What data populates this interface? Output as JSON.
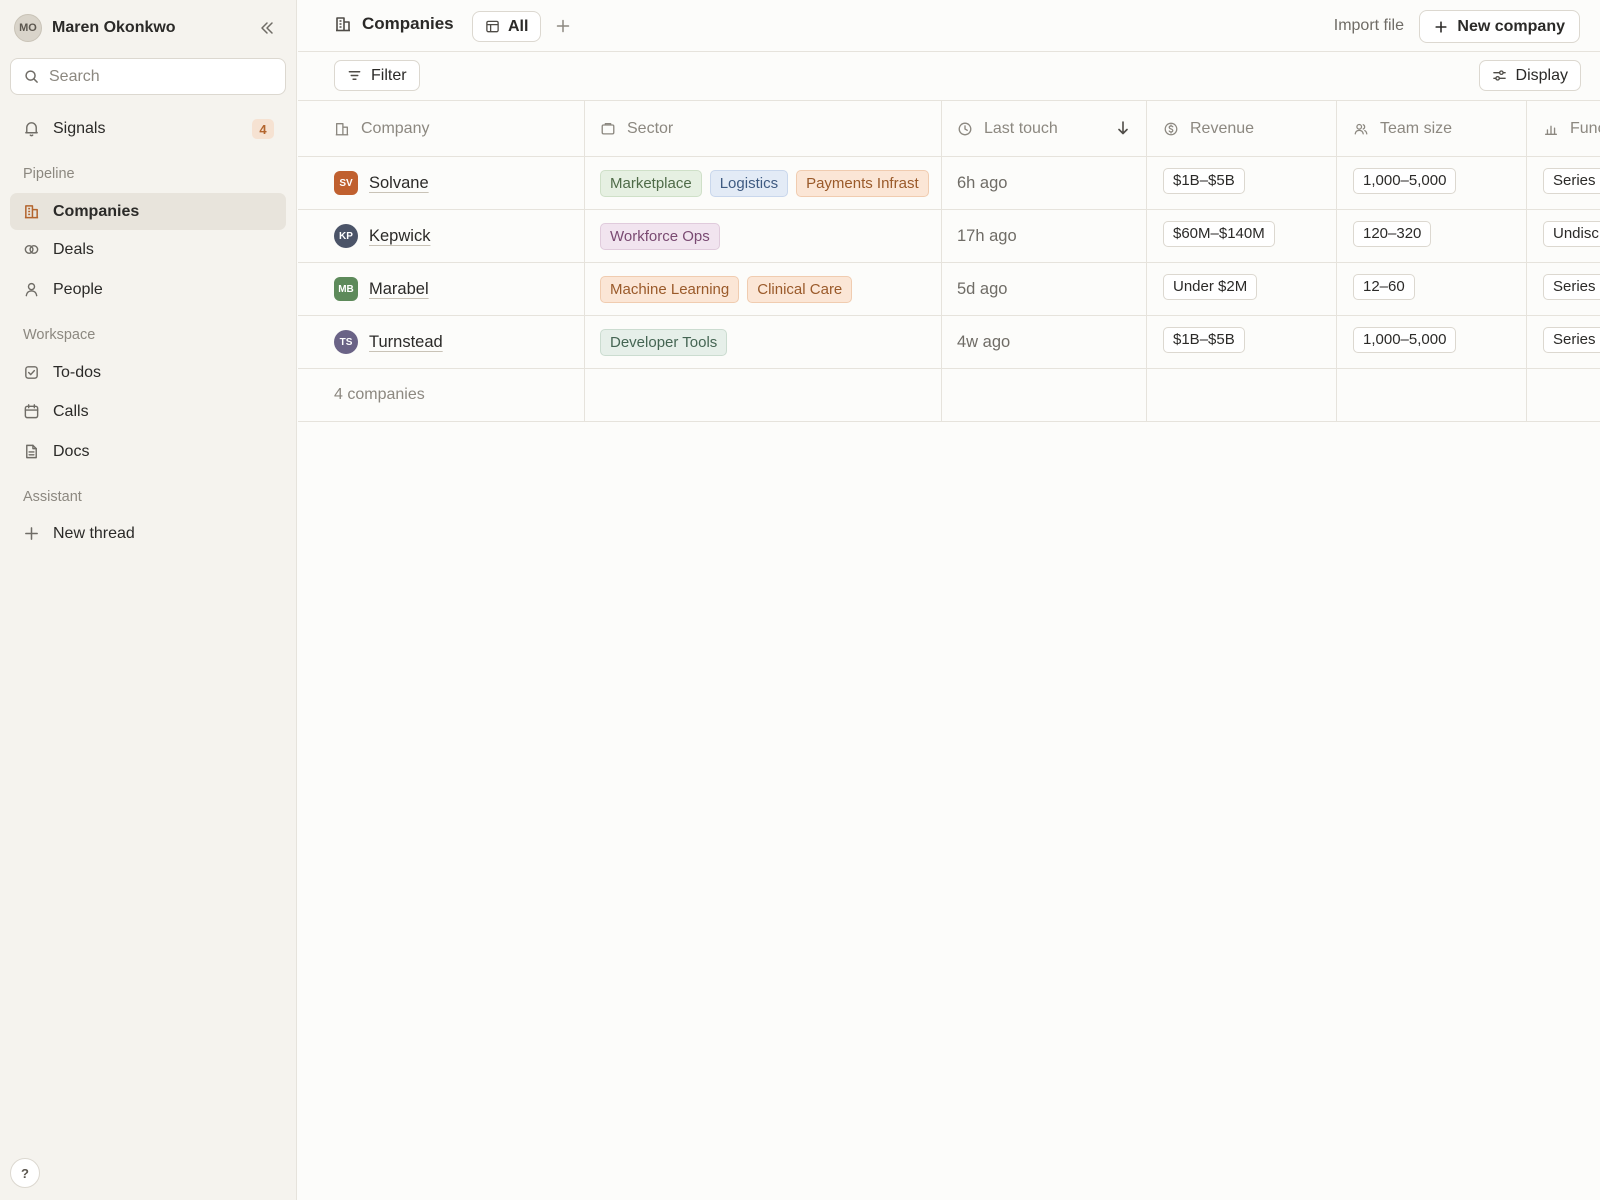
{
  "user": {
    "initials": "MO",
    "name": "Maren Okonkwo"
  },
  "search": {
    "placeholder": "Search"
  },
  "sidebar": {
    "signals": {
      "label": "Signals",
      "count": "4"
    },
    "sections": {
      "pipeline": "Pipeline",
      "workspace": "Workspace",
      "assistant": "Assistant"
    },
    "pipeline_items": [
      {
        "label": "Companies",
        "icon": "building-icon"
      },
      {
        "label": "Deals",
        "icon": "deals-icon"
      },
      {
        "label": "People",
        "icon": "person-icon"
      }
    ],
    "workspace_items": [
      {
        "label": "To-dos",
        "icon": "checkbox-icon"
      },
      {
        "label": "Calls",
        "icon": "calendar-icon"
      },
      {
        "label": "Docs",
        "icon": "document-icon"
      }
    ],
    "assistant_items": [
      {
        "label": "New thread",
        "icon": "plus-icon"
      }
    ],
    "help": "?"
  },
  "header": {
    "title": "Companies",
    "view_tab": "All",
    "import_label": "Import file",
    "new_label": "New company"
  },
  "toolbar": {
    "filter_label": "Filter",
    "display_label": "Display"
  },
  "table": {
    "columns": [
      "Company",
      "Sector",
      "Last touch",
      "Revenue",
      "Team size",
      "Func"
    ],
    "rows": [
      {
        "initials": "SV",
        "avatar_color": "#c0602f",
        "name": "Solvane",
        "tags": [
          "Marketplace",
          "Logistics",
          "Payments Infrast"
        ],
        "last_touch": "6h ago",
        "revenue": "$1B–$5B",
        "team_size": "1,000–5,000",
        "funding": "Series"
      },
      {
        "initials": "KP",
        "avatar_color": "#4b5468",
        "name": "Kepwick",
        "tags": [
          "Workforce Ops"
        ],
        "last_touch": "17h ago",
        "revenue": "$60M–$140M",
        "team_size": "120–320",
        "funding": "Undisc"
      },
      {
        "initials": "MB",
        "avatar_color": "#5d8a5a",
        "name": "Marabel",
        "tags": [
          "Machine Learning",
          "Clinical Care"
        ],
        "last_touch": "5d ago",
        "revenue": "Under $2M",
        "team_size": "12–60",
        "funding": "Series"
      },
      {
        "initials": "TS",
        "avatar_color": "#6a6386",
        "name": "Turnstead",
        "tags": [
          "Developer Tools"
        ],
        "last_touch": "4w ago",
        "revenue": "$1B–$5B",
        "team_size": "1,000–5,000",
        "funding": "Series"
      }
    ],
    "footer": "4 companies"
  },
  "colors": {
    "accent": "#b3652e",
    "tag_styles": {
      "Marketplace": {
        "bg": "#e6f0e2",
        "border": "#cfe0c8",
        "fg": "#4f6b48"
      },
      "Logistics": {
        "bg": "#e3ebf6",
        "border": "#c9d7ec",
        "fg": "#3f5b82"
      },
      "Payments Infrast": {
        "bg": "#fbe6d6",
        "border": "#f0ccb0",
        "fg": "#9a5a2a"
      },
      "Workforce Ops": {
        "bg": "#f1e4ef",
        "border": "#e0cbdc",
        "fg": "#7a4a72"
      },
      "Machine Learning": {
        "bg": "#fbe6d6",
        "border": "#f0ccb0",
        "fg": "#9a5a2a"
      },
      "Clinical Care": {
        "bg": "#fbe6d6",
        "border": "#f0ccb0",
        "fg": "#9a5a2a"
      },
      "Developer Tools": {
        "bg": "#e6efe9",
        "border": "#cbdcd0",
        "fg": "#456553"
      }
    }
  }
}
